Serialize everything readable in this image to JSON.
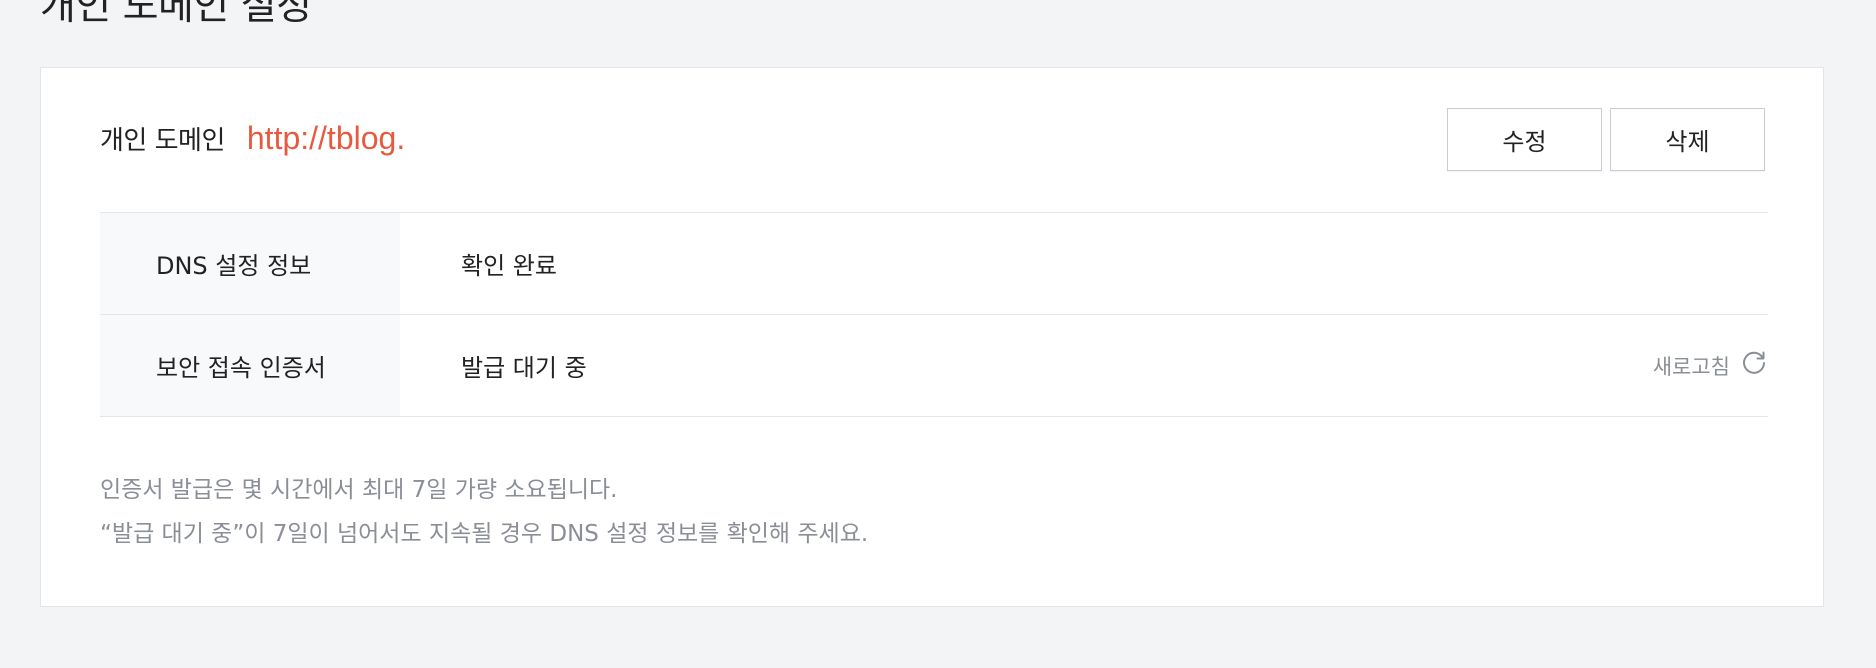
{
  "page": {
    "title": "개인 도메인 설정"
  },
  "domain": {
    "label": "개인 도메인",
    "value": "http://tblog."
  },
  "buttons": {
    "edit_label": "수정",
    "delete_label": "삭제"
  },
  "info_rows": [
    {
      "key": "DNS 설정 정보",
      "value": "확인 완료"
    },
    {
      "key": "보안 접속 인증서",
      "value": "발급 대기 중"
    }
  ],
  "refresh": {
    "label": "새로고침",
    "icon": "refresh-icon"
  },
  "notes": [
    "인증서 발급은 몇 시간에서 최대 7일 가량 소요됩니다.",
    "“발급 대기 중”이 7일이 넘어서도 지속될 경우 DNS 설정 정보를 확인해 주세요."
  ],
  "colors": {
    "accent": "#e85a3f",
    "muted_text": "#8a8e96",
    "background": "#f3f4f6"
  }
}
